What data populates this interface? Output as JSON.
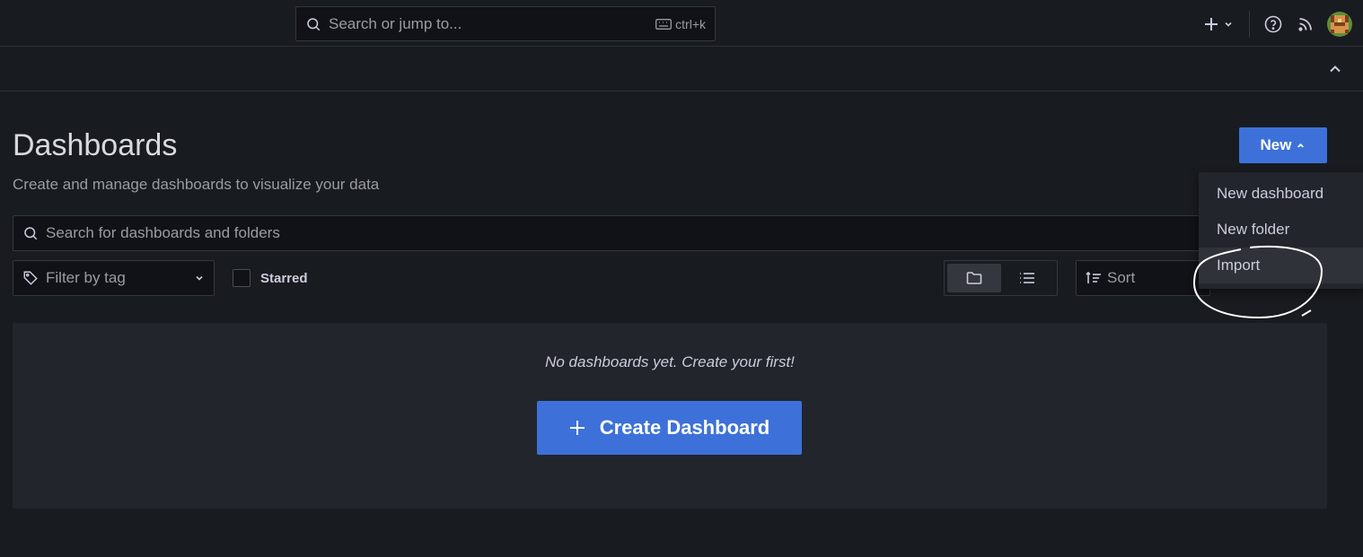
{
  "topbar": {
    "search_placeholder": "Search or jump to...",
    "shortcut": "ctrl+k",
    "icons": [
      "plus-icon",
      "chevron-down-icon",
      "help-icon",
      "rss-icon",
      "avatar"
    ]
  },
  "page": {
    "title": "Dashboards",
    "subtitle": "Create and manage dashboards to visualize your data"
  },
  "new_button": {
    "label": "New"
  },
  "new_menu": {
    "items": [
      {
        "label": "New dashboard"
      },
      {
        "label": "New folder"
      },
      {
        "label": "Import"
      }
    ]
  },
  "filters": {
    "search_placeholder": "Search for dashboards and folders",
    "tag_label": "Filter by tag",
    "starred_label": "Starred",
    "sort_label": "Sort"
  },
  "empty_state": {
    "message": "No dashboards yet. Create your first!",
    "button_label": "Create Dashboard"
  },
  "colors": {
    "background": "#181b1f",
    "panel": "#22252b",
    "primary": "#3d71d9"
  }
}
